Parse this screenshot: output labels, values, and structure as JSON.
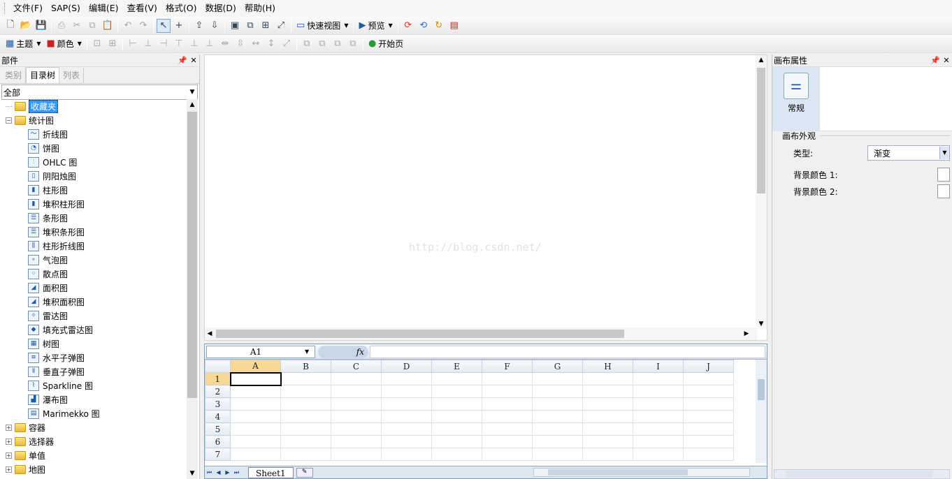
{
  "menu": [
    "文件(F)",
    "SAP(S)",
    "编辑(E)",
    "查看(V)",
    "格式(O)",
    "数据(D)",
    "帮助(H)"
  ],
  "toolbar1": {
    "quick_view": "快速视图",
    "preview": "预览"
  },
  "toolbar2": {
    "theme": "主题",
    "color": "颜色",
    "start_page": "开始页"
  },
  "left_panel": {
    "title": "部件",
    "tabs": [
      "类别",
      "目录树",
      "列表"
    ],
    "filter": "全部",
    "favorites": "收藏夹",
    "stat_charts": "统计图",
    "charts": [
      "折线图",
      "饼图",
      "OHLC 图",
      "阴阳烛图",
      "柱形图",
      "堆积柱形图",
      "条形图",
      "堆积条形图",
      "柱形折线图",
      "气泡图",
      "散点图",
      "面积图",
      "堆积面积图",
      "雷达图",
      "填充式雷达图",
      "树图",
      "水平子弹图",
      "垂直子弹图",
      "Sparkline 图",
      "瀑布图",
      "Marimekko 图"
    ],
    "groups": [
      "容器",
      "选择器",
      "单值",
      "地图"
    ]
  },
  "canvas": {
    "watermark": "http://blog.csdn.net/"
  },
  "spreadsheet": {
    "cell_ref": "A1",
    "fx": "fx",
    "columns": [
      "A",
      "B",
      "C",
      "D",
      "E",
      "F",
      "G",
      "H",
      "I",
      "J"
    ],
    "rows": [
      "1",
      "2",
      "3",
      "4",
      "5",
      "6",
      "7"
    ],
    "sheet_tab": "Sheet1"
  },
  "right_panel": {
    "title": "画布属性",
    "general": "常规",
    "section": "画布外观",
    "type_label": "类型:",
    "type_value": "渐变",
    "bg1_label": "背景颜色 1:",
    "bg2_label": "背景颜色 2:"
  }
}
